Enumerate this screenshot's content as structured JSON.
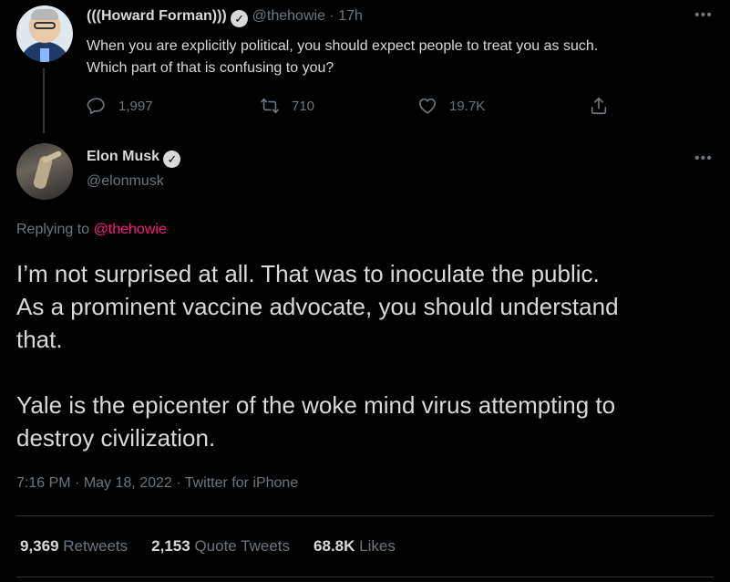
{
  "parent_tweet": {
    "display_name": "(((Howard Forman)))",
    "handle": "@thehowie",
    "separator": "·",
    "time": "17h",
    "text_line1": "When you are explicitly political, you should expect people to treat you as such.",
    "text_line2": "Which part of that is confusing to you?",
    "replies": "1,997",
    "retweets": "710",
    "likes": "19.7K"
  },
  "main_tweet": {
    "display_name": "Elon Musk",
    "handle": "@elonmusk",
    "replying_prefix": "Replying to",
    "replying_handle": "@thehowie",
    "text": "I’m not surprised at all. That was to inoculate the public.\nAs a prominent vaccine advocate, you should understand\nthat.\n\nYale is the epicenter of the woke mind virus attempting to\ndestroy civilization.",
    "time": "7:16 PM",
    "date": "May 18, 2022",
    "source": "Twitter for iPhone",
    "meta_separator": "·"
  },
  "stats": {
    "retweets_count": "9,369",
    "retweets_label": "Retweets",
    "quotes_count": "2,153",
    "quotes_label": "Quote Tweets",
    "likes_count": "68.8K",
    "likes_label": "Likes"
  },
  "icons": {
    "more": "more-icon",
    "verified": "verified-icon",
    "reply": "reply-icon",
    "retweet": "retweet-icon",
    "like": "heart-icon",
    "share": "share-icon"
  },
  "colors": {
    "background": "#000000",
    "text": "#d9d9d9",
    "muted": "#6e767d",
    "link": "#f91880",
    "divider": "#2f3336"
  }
}
